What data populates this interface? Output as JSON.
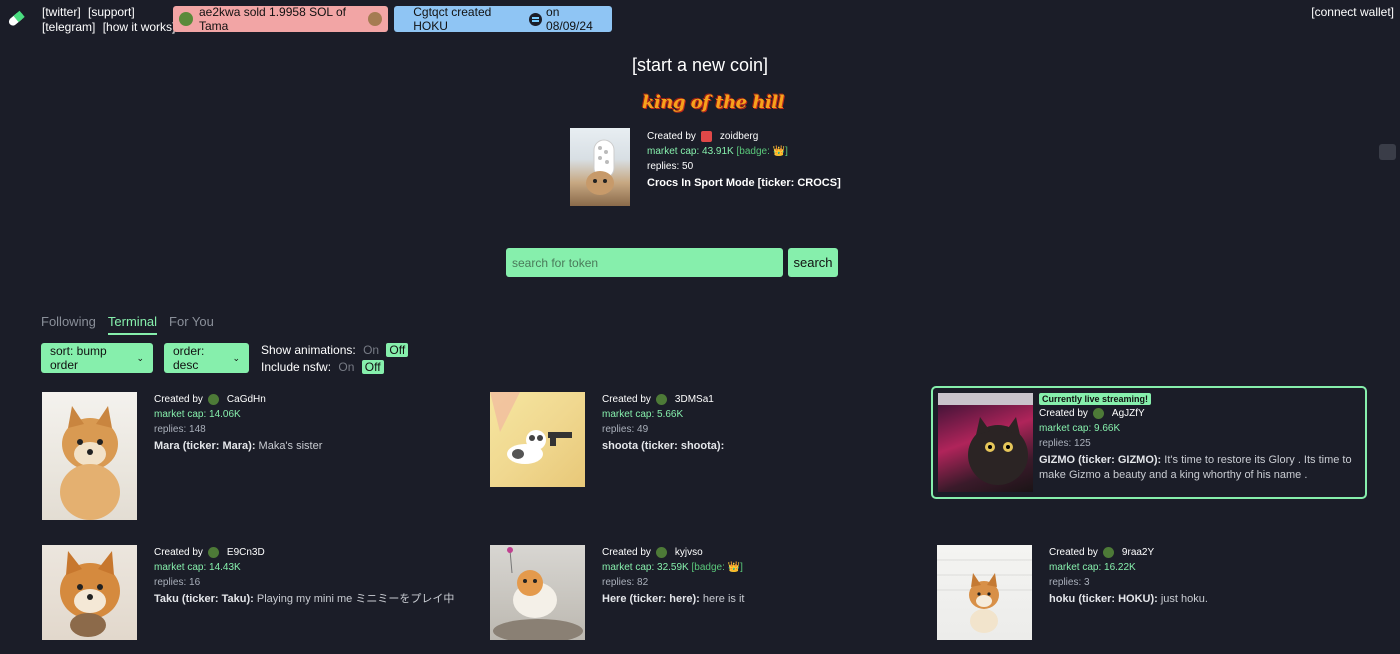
{
  "header": {
    "links_row1": [
      "[twitter]",
      "[support]"
    ],
    "links_row2": [
      "[telegram]",
      "[how it works]"
    ],
    "ticker_trade": "ae2kwa  sold 1.9958 SOL of Tama",
    "ticker_create_prefix": "Cgtqct created HOKU",
    "ticker_create_suffix": "on 08/09/24",
    "connect_wallet": "[connect wallet]",
    "colors": {
      "trade_bg": "#f2a5a5",
      "create_bg": "#8fc5f4",
      "accent": "#86efac",
      "page_bg": "#1b1d28"
    }
  },
  "start_new_coin": "[start a new coin]",
  "king_of_the_hill": {
    "banner": "king of the hill",
    "created_by": "Created by",
    "creator": "zoidberg",
    "market_cap": "market cap: 43.91K",
    "badge": "[badge: 👑]",
    "replies": "replies: 50",
    "title": "Crocs In Sport Mode [ticker: CROCS]"
  },
  "search": {
    "placeholder": "search for token",
    "button": "search"
  },
  "tabs": [
    "Following",
    "Terminal",
    "For You"
  ],
  "active_tab": "Terminal",
  "controls": {
    "sort": "sort: bump order",
    "order": "order: desc",
    "show_animations": "Show animations:",
    "include_nsfw": "Include nsfw:",
    "on": "On",
    "off": "Off"
  },
  "coins": [
    {
      "created_by": "Created by",
      "creator": "CaGdHn",
      "market_cap": "market cap: 14.06K",
      "badge": "",
      "replies": "replies: 148",
      "name": "Mara (ticker: Mara):",
      "description": "Maka's sister",
      "live": ""
    },
    {
      "created_by": "Created by",
      "creator": "3DMSa1",
      "market_cap": "market cap: 5.66K",
      "badge": "",
      "replies": "replies: 49",
      "name": "shoota (ticker: shoota):",
      "description": "",
      "live": ""
    },
    {
      "created_by": "Created by",
      "creator": "AgJZfY",
      "market_cap": "market cap: 9.66K",
      "badge": "",
      "replies": "replies: 125",
      "name": "GIZMO (ticker: GIZMO):",
      "description": "It's time to restore its Glory . Its time to make Gizmo a beauty and a king whorthy of his name .",
      "live": "Currently live streaming!"
    },
    {
      "created_by": "Created by",
      "creator": "E9Cn3D",
      "market_cap": "market cap: 14.43K",
      "badge": "",
      "replies": "replies: 16",
      "name": "Taku (ticker: Taku):",
      "description": "Playing my mini me ミニミーをプレイ中",
      "live": ""
    },
    {
      "created_by": "Created by",
      "creator": "kyjvso",
      "market_cap": "market cap: 32.59K",
      "badge": "[badge: 👑]",
      "replies": "replies: 82",
      "name": "Here (ticker: here):",
      "description": "here is it",
      "live": ""
    },
    {
      "created_by": "Created by",
      "creator": "9raa2Y",
      "market_cap": "market cap: 16.22K",
      "badge": "",
      "replies": "replies: 3",
      "name": "hoku (ticker: HOKU):",
      "description": "just hoku.",
      "live": ""
    }
  ]
}
